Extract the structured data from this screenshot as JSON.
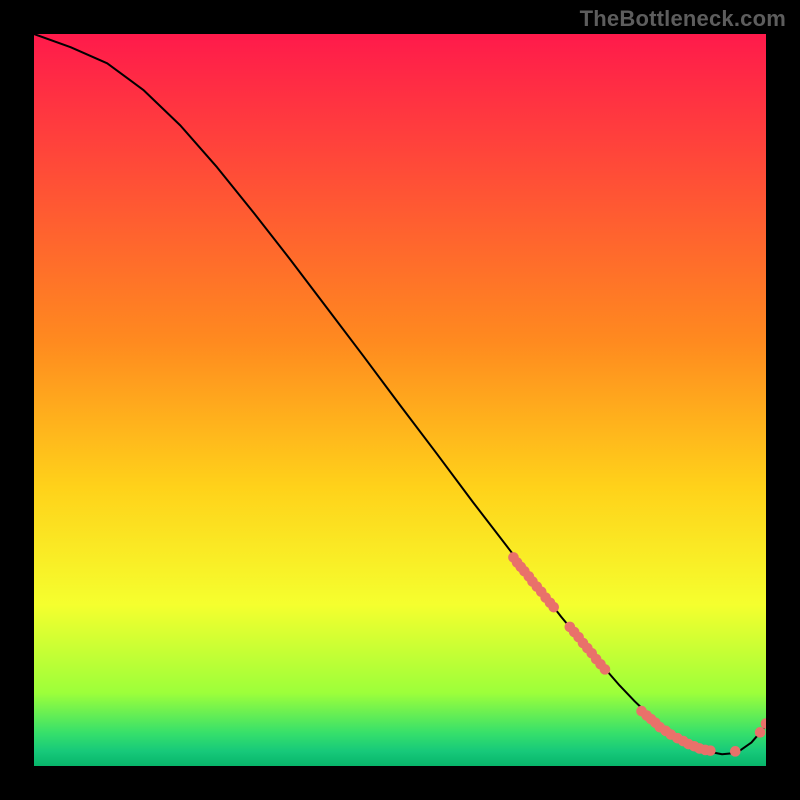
{
  "watermark": "TheBottleneck.com",
  "chart_data": {
    "type": "line",
    "title": "",
    "xlabel": "",
    "ylabel": "",
    "xlim": [
      0,
      100
    ],
    "ylim": [
      0,
      100
    ],
    "curve": {
      "x": [
        0,
        5,
        10,
        15,
        20,
        25,
        30,
        35,
        40,
        45,
        50,
        55,
        60,
        65,
        70,
        72,
        75,
        78,
        80,
        82,
        84,
        86,
        88,
        90,
        92,
        94,
        96,
        98,
        100
      ],
      "y": [
        100,
        98.2,
        96,
        92.3,
        87.5,
        81.8,
        75.6,
        69.2,
        62.6,
        56,
        49.3,
        42.7,
        36,
        29.5,
        23,
        20.4,
        16.8,
        13.3,
        11,
        8.9,
        7,
        5.3,
        3.9,
        2.8,
        2,
        1.6,
        1.8,
        3.2,
        5.5
      ]
    },
    "scatter_clusters": [
      {
        "name": "upper-band",
        "points": [
          [
            65.5,
            28.5
          ],
          [
            66.0,
            27.8
          ],
          [
            66.5,
            27.2
          ],
          [
            67.0,
            26.6
          ],
          [
            67.6,
            25.9
          ],
          [
            68.1,
            25.2
          ],
          [
            68.7,
            24.5
          ],
          [
            69.3,
            23.8
          ],
          [
            69.9,
            23.0
          ],
          [
            70.5,
            22.3
          ],
          [
            71.0,
            21.7
          ],
          [
            73.2,
            19.0
          ],
          [
            73.8,
            18.3
          ],
          [
            74.4,
            17.6
          ],
          [
            75.0,
            16.8
          ],
          [
            75.6,
            16.1
          ],
          [
            76.2,
            15.4
          ],
          [
            76.8,
            14.6
          ],
          [
            77.4,
            13.9
          ],
          [
            78.0,
            13.2
          ]
        ]
      },
      {
        "name": "valley-band",
        "points": [
          [
            83.0,
            7.5
          ],
          [
            83.7,
            6.9
          ],
          [
            84.3,
            6.4
          ],
          [
            84.9,
            5.9
          ],
          [
            85.5,
            5.3
          ],
          [
            86.3,
            4.8
          ],
          [
            87.0,
            4.3
          ],
          [
            87.9,
            3.8
          ],
          [
            88.7,
            3.4
          ],
          [
            89.4,
            3.0
          ],
          [
            90.2,
            2.7
          ],
          [
            90.9,
            2.4
          ],
          [
            91.7,
            2.2
          ],
          [
            92.4,
            2.1
          ],
          [
            95.8,
            2.0
          ]
        ]
      },
      {
        "name": "upturn",
        "points": [
          [
            99.2,
            4.6
          ],
          [
            100.0,
            5.8
          ]
        ]
      }
    ],
    "gradient_stops": [
      {
        "offset": 0.0,
        "color": "#ff1a4b"
      },
      {
        "offset": 0.42,
        "color": "#ff8a1f"
      },
      {
        "offset": 0.62,
        "color": "#ffd21a"
      },
      {
        "offset": 0.78,
        "color": "#f5ff2e"
      },
      {
        "offset": 0.9,
        "color": "#9dff3a"
      },
      {
        "offset": 0.955,
        "color": "#36e06b"
      },
      {
        "offset": 0.98,
        "color": "#17c97a"
      },
      {
        "offset": 1.0,
        "color": "#07b56a"
      }
    ],
    "colors": {
      "marker": "#e9716a",
      "line": "#000000"
    }
  }
}
